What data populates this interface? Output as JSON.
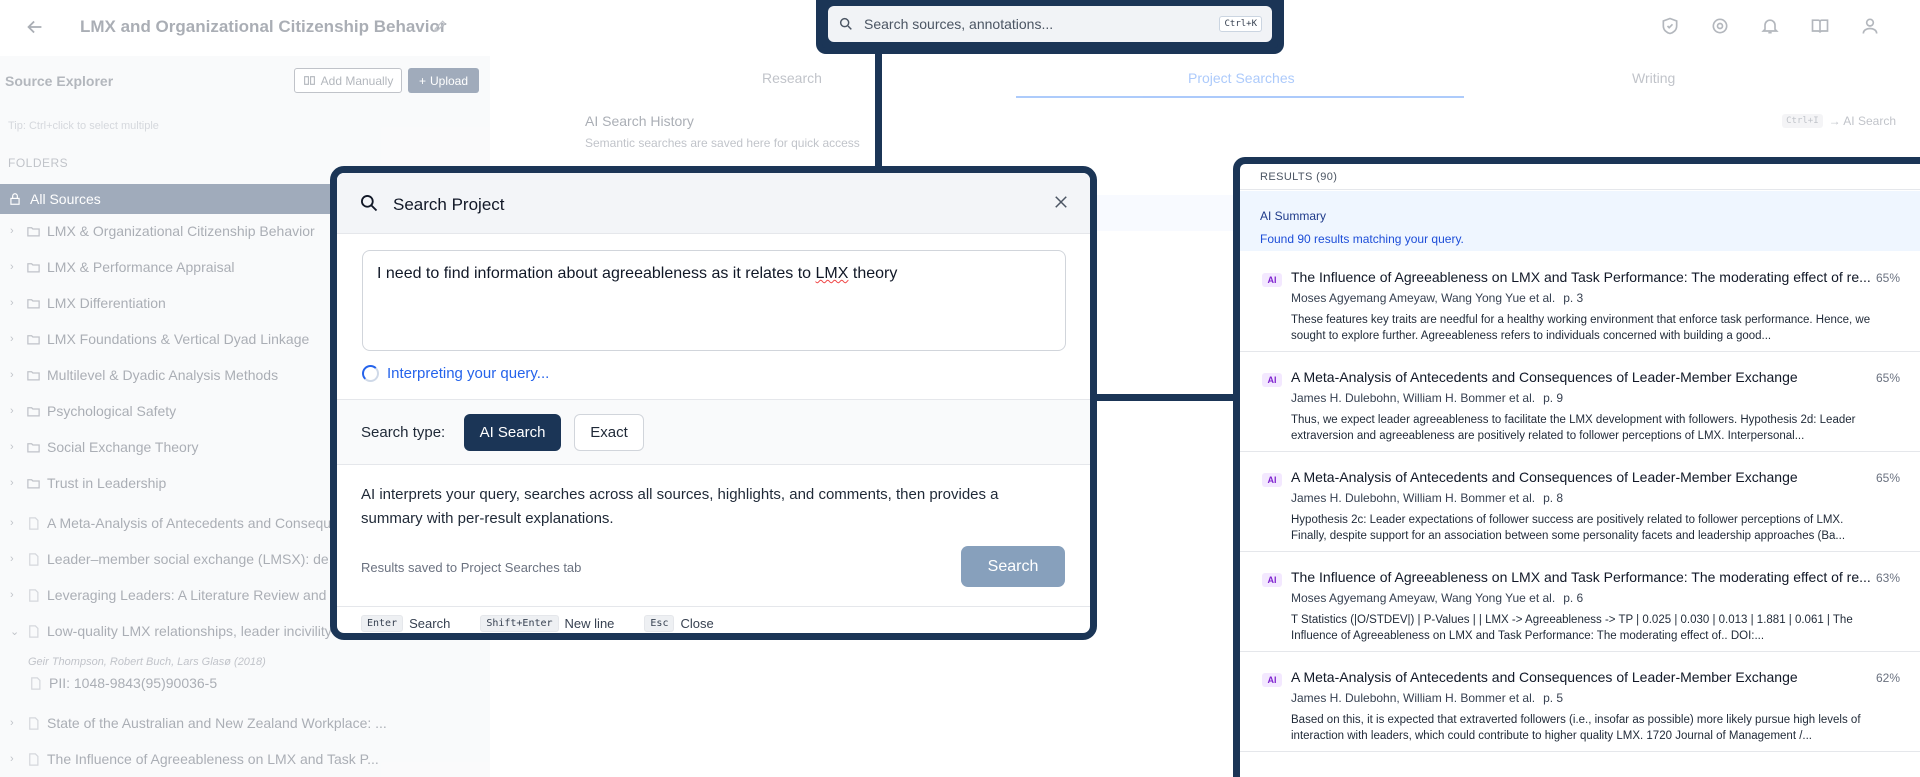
{
  "app": {
    "title": "LMX and Organizational Citizenship Behavior"
  },
  "search_bar": {
    "placeholder": "Search sources, annotations...",
    "shortcut": "Ctrl+K"
  },
  "sidebar": {
    "title": "Source Explorer",
    "add_manually": "Add Manually",
    "upload": "Upload",
    "tip": "Tip: Ctrl+click to select multiple",
    "folders_label": "FOLDERS",
    "all_sources": "All Sources",
    "folders": [
      "LMX & Organizational Citizenship Behavior",
      "LMX & Performance Appraisal",
      "LMX Differentiation",
      "LMX Foundations & Vertical Dyad Linkage",
      "Multilevel & Dyadic Analysis Methods",
      "Psychological Safety",
      "Social Exchange Theory",
      "Trust in Leadership"
    ],
    "documents": [
      "A Meta-Analysis of Antecedents and Conseque",
      "Leader–member social exchange (LMSX): de",
      "Leveraging Leaders: A Literature Review and",
      "Low-quality LMX relationships, leader incivility"
    ],
    "expanded_authors": "Geir Thompson, Robert Buch, Lars Glasø (2018)",
    "expanded_child": "PII: 1048-9843(95)90036-5",
    "more_documents": [
      "State of the Australian and New Zealand Workplace: ...",
      "The Influence of Agreeableness on LMX and Task P..."
    ]
  },
  "main": {
    "tabs": [
      "Research",
      "Project Searches",
      "Writing"
    ],
    "active_tab": "Project Searches",
    "history_title": "AI Search History",
    "history_subtitle": "Semantic searches are saved here for quick access",
    "history_hint_key": "Ctrl+I",
    "history_hint_text": "→ AI Search"
  },
  "modal": {
    "title": "Search Project",
    "query": "I need to find information about agreeableness as it relates to",
    "query_flagged_word": "LMX",
    "query_end": "theory",
    "status": "Interpreting your query...",
    "search_type_label": "Search type:",
    "type_options": [
      "AI Search",
      "Exact"
    ],
    "selected_type": "AI Search",
    "description": "AI interprets your query, searches across all sources, highlights, and comments, then provides a summary with per-result explanations.",
    "saved_note": "Results saved to Project Searches tab",
    "search_button": "Search",
    "shortcuts": [
      {
        "key": "Enter",
        "label": "Search"
      },
      {
        "key": "Shift+Enter",
        "label": "New line"
      },
      {
        "key": "Esc",
        "label": "Close"
      }
    ]
  },
  "results": {
    "header": "RESULTS (90)",
    "summary_label": "AI Summary",
    "summary_text": "Found 90 results matching your query.",
    "badge": "AI",
    "items": [
      {
        "title": "The Influence of Agreeableness on LMX and Task Performance: The moderating effect of re...",
        "authors": "Moses Agyemang Ameyaw, Wang Yong Yue et al.",
        "page": "p. 3",
        "score": "65%",
        "snippet": "These features key traits are needful for a healthy working environment that enforce task performance. Hence, we sought to explore further. Agreeableness refers to individuals concerned with building a good..."
      },
      {
        "title": "A Meta-Analysis of Antecedents and Consequences of Leader-Member Exchange",
        "authors": "James H. Dulebohn, William H. Bommer et al.",
        "page": "p. 9",
        "score": "65%",
        "snippet": "Thus, we expect leader agreeableness to facilitate the LMX development with followers. Hypothesis 2d: Leader extraversion and agreeableness are positively related to follower perceptions of LMX. Interpersonal..."
      },
      {
        "title": "A Meta-Analysis of Antecedents and Consequences of Leader-Member Exchange",
        "authors": "James H. Dulebohn, William H. Bommer et al.",
        "page": "p. 8",
        "score": "65%",
        "snippet": "Hypothesis 2c: Leader expectations of follower success are positively related to follower perceptions of LMX. Finally, despite support for an association between some personality facets and leadership approaches (Ba..."
      },
      {
        "title": "The Influence of Agreeableness on LMX and Task Performance: The moderating effect of re...",
        "authors": "Moses Agyemang Ameyaw, Wang Yong Yue et al.",
        "page": "p. 6",
        "score": "63%",
        "snippet": "T Statistics (|O/STDEV|) | P-Values | | LMX -> Agreeableness -> TP | 0.025 | 0.030 | 0.013 | 1.881 | 0.061 | The Influence of Agreeableness on LMX and Task Performance: The moderating effect of.. DOI:..."
      },
      {
        "title": "A Meta-Analysis of Antecedents and Consequences of Leader-Member Exchange",
        "authors": "James H. Dulebohn, William H. Bommer et al.",
        "page": "p. 5",
        "score": "62%",
        "snippet": "Based on this, it is expected that extraverted followers (i.e., insofar as possible) more likely pursue high levels of interaction with leaders, which could contribute to higher quality LMX. 1720        Journal of Management /..."
      }
    ]
  }
}
